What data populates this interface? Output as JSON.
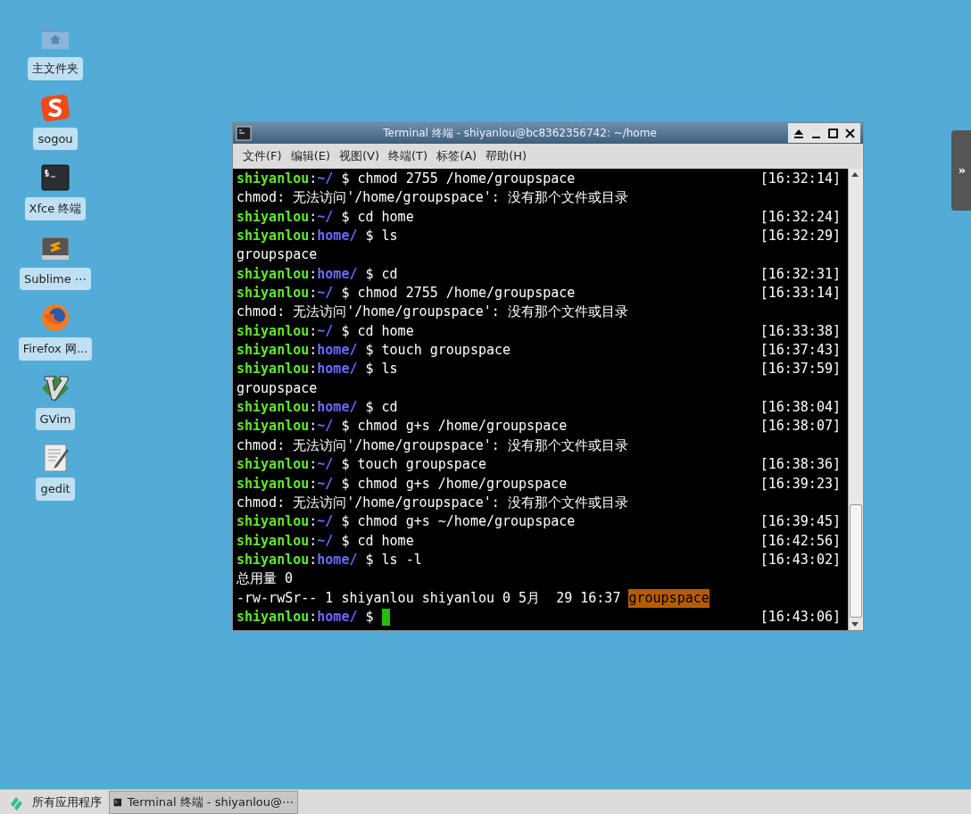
{
  "desktop_icons": [
    {
      "label": "主文件夹",
      "kind": "folder"
    },
    {
      "label": "sogou",
      "kind": "sogou"
    },
    {
      "label": "Xfce 终端",
      "kind": "terminal"
    },
    {
      "label": "Sublime ⋯",
      "kind": "sublime"
    },
    {
      "label": "Firefox 网...",
      "kind": "firefox"
    },
    {
      "label": "GVim",
      "kind": "vim"
    },
    {
      "label": "gedit",
      "kind": "gedit"
    }
  ],
  "side_panel": {
    "toggle": "»"
  },
  "window": {
    "title": "Terminal 终端 - shiyanlou@bc8362356742: ~/home",
    "menu": [
      "文件(F)",
      "编辑(E)",
      "视图(V)",
      "终端(T)",
      "标签(A)",
      "帮助(H)"
    ],
    "lines": [
      {
        "kind": "prompt",
        "user": "shiyanlou",
        "separator": ":",
        "path": "~/",
        "command": "$ chmod 2755 /home/groupspace",
        "time": "[16:32:14]"
      },
      {
        "kind": "output",
        "text": "chmod: 无法访问'/home/groupspace': 没有那个文件或目录"
      },
      {
        "kind": "prompt",
        "user": "shiyanlou",
        "separator": ":",
        "path": "~/",
        "command": "$ cd home",
        "time": "[16:32:24]"
      },
      {
        "kind": "prompt",
        "user": "shiyanlou",
        "separator": ":",
        "path": "home/",
        "command": "$ ls",
        "time": "[16:32:29]"
      },
      {
        "kind": "output",
        "text": "groupspace"
      },
      {
        "kind": "prompt",
        "user": "shiyanlou",
        "separator": ":",
        "path": "home/",
        "command": "$ cd",
        "time": "[16:32:31]"
      },
      {
        "kind": "prompt",
        "user": "shiyanlou",
        "separator": ":",
        "path": "~/",
        "command": "$ chmod 2755 /home/groupspace",
        "time": "[16:33:14]"
      },
      {
        "kind": "output",
        "text": "chmod: 无法访问'/home/groupspace': 没有那个文件或目录"
      },
      {
        "kind": "prompt",
        "user": "shiyanlou",
        "separator": ":",
        "path": "~/",
        "command": "$ cd home",
        "time": "[16:33:38]"
      },
      {
        "kind": "prompt",
        "user": "shiyanlou",
        "separator": ":",
        "path": "home/",
        "command": "$ touch groupspace",
        "time": "[16:37:43]"
      },
      {
        "kind": "prompt",
        "user": "shiyanlou",
        "separator": ":",
        "path": "home/",
        "command": "$ ls",
        "time": "[16:37:59]"
      },
      {
        "kind": "output",
        "text": "groupspace"
      },
      {
        "kind": "prompt",
        "user": "shiyanlou",
        "separator": ":",
        "path": "home/",
        "command": "$ cd",
        "time": "[16:38:04]"
      },
      {
        "kind": "prompt",
        "user": "shiyanlou",
        "separator": ":",
        "path": "~/",
        "command": "$ chmod g+s /home/groupspace",
        "time": "[16:38:07]"
      },
      {
        "kind": "output",
        "text": "chmod: 无法访问'/home/groupspace': 没有那个文件或目录"
      },
      {
        "kind": "prompt",
        "user": "shiyanlou",
        "separator": ":",
        "path": "~/",
        "command": "$ touch groupspace",
        "time": "[16:38:36]"
      },
      {
        "kind": "prompt",
        "user": "shiyanlou",
        "separator": ":",
        "path": "~/",
        "command": "$ chmod g+s /home/groupspace",
        "time": "[16:39:23]"
      },
      {
        "kind": "output",
        "text": "chmod: 无法访问'/home/groupspace': 没有那个文件或目录"
      },
      {
        "kind": "prompt",
        "user": "shiyanlou",
        "separator": ":",
        "path": "~/",
        "command": "$ chmod g+s ~/home/groupspace",
        "time": "[16:39:45]"
      },
      {
        "kind": "prompt",
        "user": "shiyanlou",
        "separator": ":",
        "path": "~/",
        "command": "$ cd home",
        "time": "[16:42:56]"
      },
      {
        "kind": "prompt",
        "user": "shiyanlou",
        "separator": ":",
        "path": "home/",
        "command": "$ ls -l",
        "time": "[16:43:02]"
      },
      {
        "kind": "output",
        "text": "总用量 0"
      },
      {
        "kind": "output",
        "text": "-rw-rwSr-- 1 shiyanlou shiyanlou 0 5月  29 16:37",
        "highlight": "groupspace"
      },
      {
        "kind": "prompt",
        "user": "shiyanlou",
        "separator": ":",
        "path": "home/",
        "command": "$",
        "time": "[16:43:06]",
        "cursor": true
      }
    ]
  },
  "taskbar": {
    "start": "所有应用程序",
    "tasks": [
      {
        "label": "Terminal 终端 - shiyanlou@⋯",
        "selected": true
      }
    ]
  }
}
